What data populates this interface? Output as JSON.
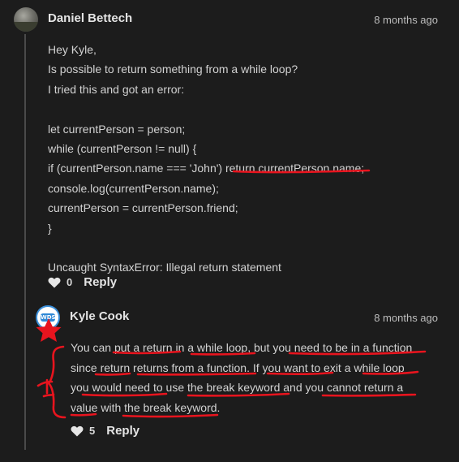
{
  "comment": {
    "author": "Daniel Bettech",
    "timestamp": "8 months ago",
    "lines": [
      "Hey Kyle,",
      "Is possible to return something from a while loop?",
      "I tried this and got an error:",
      "",
      "let currentPerson = person;",
      "while (currentPerson != null) {",
      "if (currentPerson.name === 'John') return currentPerson.name;",
      "console.log(currentPerson.name);",
      "currentPerson = currentPerson.friend;",
      "}",
      "",
      "Uncaught SyntaxError: Illegal return statement"
    ],
    "likes": "0",
    "reply_label": "Reply"
  },
  "reply": {
    "author": "Kyle Cook",
    "timestamp": "8 months ago",
    "avatar_badge": "WDS",
    "lines": [
      "You can put a return in a while loop, but you need to be in a function",
      "since return returns from a function. If you want to exit a while loop",
      "you would need to use the break keyword and you cannot return a",
      "value with the break keyword."
    ],
    "likes": "5",
    "reply_label": "Reply"
  },
  "colors": {
    "background": "#1c1c1c",
    "annotation": "#e8141e",
    "thread_line": "#4a4a4a"
  },
  "icons": [
    "heart-icon",
    "star-icon",
    "avatar"
  ]
}
